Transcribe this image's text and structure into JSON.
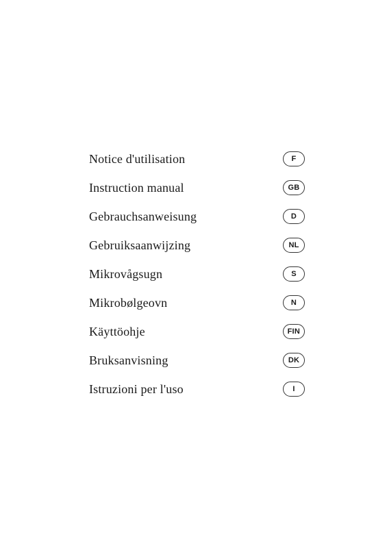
{
  "manuals": [
    {
      "label": "Notice d'utilisation",
      "badge": "F"
    },
    {
      "label": "Instruction manual",
      "badge": "GB"
    },
    {
      "label": "Gebrauchsanweisung",
      "badge": "D"
    },
    {
      "label": "Gebruiksaanwijzing",
      "badge": "NL"
    },
    {
      "label": "Mikrovågsugn",
      "badge": "S"
    },
    {
      "label": "Mikrobølgeovn",
      "badge": "N"
    },
    {
      "label": "Käyttöohje",
      "badge": "FIN"
    },
    {
      "label": "Bruksanvisning",
      "badge": "DK"
    },
    {
      "label": "Istruzioni per l'uso",
      "badge": "I"
    }
  ]
}
